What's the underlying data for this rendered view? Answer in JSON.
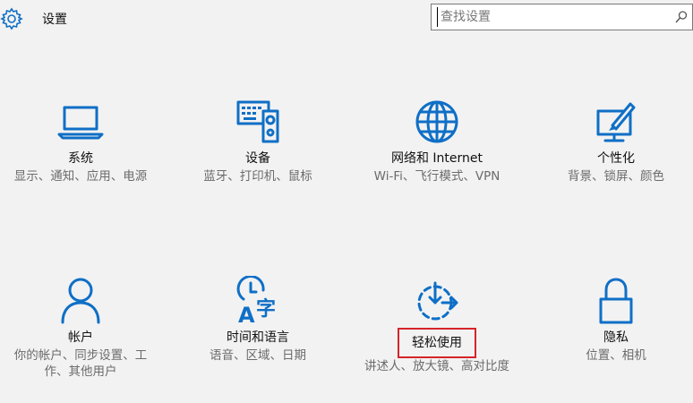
{
  "header": {
    "title": "设置",
    "search_placeholder": "查找设置",
    "icons": {
      "settings": "gear-icon",
      "search": "search-icon"
    }
  },
  "accent_color": "#0f6fc6",
  "highlight_color": "#d6242a",
  "tiles": [
    {
      "title": "系统",
      "description": "显示、通知、应用、电源",
      "icon": "laptop-icon"
    },
    {
      "title": "设备",
      "description": "蓝牙、打印机、鼠标",
      "icon": "devices-icon"
    },
    {
      "title": "网络和 Internet",
      "description": "Wi-Fi、飞行模式、VPN",
      "icon": "globe-icon"
    },
    {
      "title": "个性化",
      "description": "背景、锁屏、颜色",
      "icon": "personalization-icon"
    },
    {
      "title": "帐户",
      "description": "你的帐户、同步设置、工作、其他用户",
      "icon": "person-icon"
    },
    {
      "title": "时间和语言",
      "description": "语音、区域、日期",
      "icon": "time-language-icon"
    },
    {
      "title": "轻松使用",
      "description": "讲述人、放大镜、高对比度",
      "icon": "ease-of-access-icon",
      "highlighted": true
    },
    {
      "title": "隐私",
      "description": "位置、相机",
      "icon": "lock-icon"
    }
  ]
}
